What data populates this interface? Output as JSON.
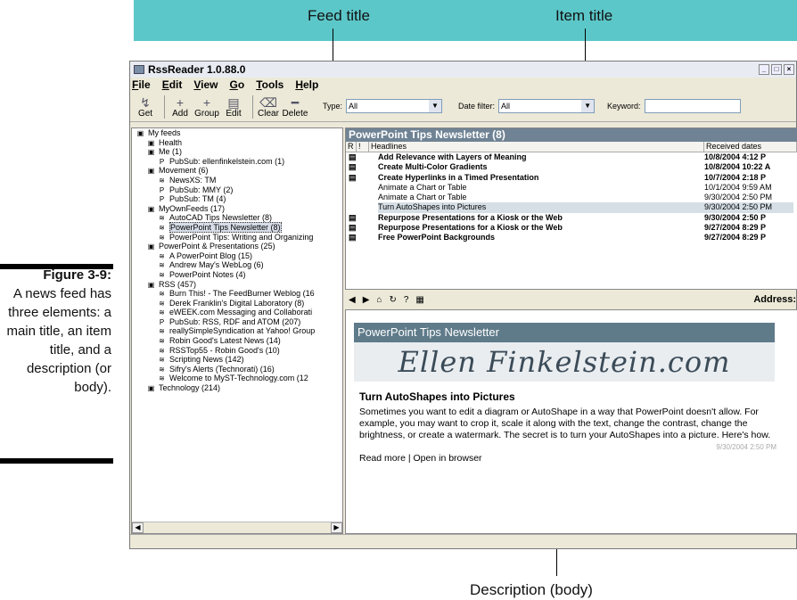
{
  "callouts": {
    "feed_title": "Feed title",
    "item_title": "Item title",
    "description": "Description (body)"
  },
  "caption": {
    "label": "Figure 3-9:",
    "text": "A news feed has three elements: a main title, an item title, and a description (or body)."
  },
  "window": {
    "title": "RssReader  1.0.88.0",
    "menu": [
      "File",
      "Edit",
      "View",
      "Go",
      "Tools",
      "Help"
    ],
    "toolbar": [
      "Get",
      "Add",
      "Group",
      "Edit",
      "Clear",
      "Delete"
    ],
    "filters": {
      "type_label": "Type:",
      "type_value": "All",
      "date_label": "Date filter:",
      "date_value": "All",
      "keyword_label": "Keyword:",
      "keyword_value": ""
    }
  },
  "tree": [
    {
      "level": 0,
      "icon": "folder",
      "label": "My feeds"
    },
    {
      "level": 1,
      "icon": "folder",
      "label": "Health"
    },
    {
      "level": 1,
      "icon": "folder",
      "label": "Me (1)"
    },
    {
      "level": 2,
      "icon": "pubsub",
      "label": "PubSub: ellenfinkelstein.com (1)"
    },
    {
      "level": 1,
      "icon": "folder",
      "label": "Movement (6)"
    },
    {
      "level": 2,
      "icon": "feed",
      "label": "NewsXS: TM"
    },
    {
      "level": 2,
      "icon": "pubsub",
      "label": "PubSub: MMY (2)"
    },
    {
      "level": 2,
      "icon": "pubsub",
      "label": "PubSub: TM (4)"
    },
    {
      "level": 1,
      "icon": "folder",
      "label": "MyOwnFeeds (17)"
    },
    {
      "level": 2,
      "icon": "feed",
      "label": "AutoCAD Tips Newsletter (8)"
    },
    {
      "level": 2,
      "icon": "feed",
      "label": "PowerPoint Tips Newsletter (8)",
      "selected": true
    },
    {
      "level": 2,
      "icon": "feed",
      "label": "PowerPoint Tips: Writing and Organizing"
    },
    {
      "level": 1,
      "icon": "folder",
      "label": "PowerPoint & Presentations (25)"
    },
    {
      "level": 2,
      "icon": "feed",
      "label": "A PowerPoint Blog (15)"
    },
    {
      "level": 2,
      "icon": "feed",
      "label": "Andrew May's WebLog (6)"
    },
    {
      "level": 2,
      "icon": "feed",
      "label": "PowerPoint Notes (4)"
    },
    {
      "level": 1,
      "icon": "folder",
      "label": "RSS (457)"
    },
    {
      "level": 2,
      "icon": "feed",
      "label": "Burn This! - The FeedBurner Weblog (16"
    },
    {
      "level": 2,
      "icon": "feed",
      "label": "Derek Franklin's Digital Laboratory (8)"
    },
    {
      "level": 2,
      "icon": "feed",
      "label": "eWEEK.com Messaging and Collaborati"
    },
    {
      "level": 2,
      "icon": "pubsub",
      "label": "PubSub: RSS, RDF and ATOM (207)"
    },
    {
      "level": 2,
      "icon": "feed",
      "label": "reallySimpleSyndication at Yahoo! Group"
    },
    {
      "level": 2,
      "icon": "feed",
      "label": "Robin Good's Latest News (14)"
    },
    {
      "level": 2,
      "icon": "feed",
      "label": "RSSTop55 - Robin Good's (10)"
    },
    {
      "level": 2,
      "icon": "feed",
      "label": "Scripting News (142)"
    },
    {
      "level": 2,
      "icon": "feed",
      "label": "Sifry's Alerts (Technorati) (16)"
    },
    {
      "level": 2,
      "icon": "feed",
      "label": "Welcome to MyST-Technology.com (12"
    },
    {
      "level": 1,
      "icon": "folder",
      "label": "Technology (214)"
    }
  ],
  "headlines": {
    "pane_title": "PowerPoint Tips Newsletter (8)",
    "columns": [
      "R",
      "!",
      "Headlines",
      "Received dates"
    ],
    "rows": [
      {
        "title": "Add Relevance with Layers of Meaning",
        "date": "10/8/2004 4:12 P",
        "bold": true
      },
      {
        "title": "Create Multi-Color Gradients",
        "date": "10/8/2004 10:22 A",
        "bold": true
      },
      {
        "title": "Create Hyperlinks in a Timed Presentation",
        "date": "10/7/2004 2:18 P",
        "bold": true
      },
      {
        "title": "Animate a Chart or Table",
        "date": "10/1/2004 9:59 AM",
        "bold": false
      },
      {
        "title": "Animate a Chart or Table",
        "date": "9/30/2004 2:50 PM",
        "bold": false
      },
      {
        "title": "Turn AutoShapes into Pictures",
        "date": "9/30/2004 2:50 PM",
        "bold": false,
        "selected": true
      },
      {
        "title": "Repurpose Presentations for a Kiosk or the Web",
        "date": "9/30/2004 2:50 P",
        "bold": true
      },
      {
        "title": "Repurpose Presentations for a Kiosk or the Web",
        "date": "9/27/2004 8:29 P",
        "bold": true
      },
      {
        "title": "Free PowerPoint Backgrounds",
        "date": "9/27/2004 8:29 P",
        "bold": true
      }
    ]
  },
  "browser": {
    "address_label": "Address:",
    "newsletter_header": "PowerPoint Tips Newsletter",
    "banner": "Ellen Finkelstein.com",
    "article_title": "Turn AutoShapes into Pictures",
    "article_body": "Sometimes you want to edit a diagram or AutoShape in a way that PowerPoint doesn't allow. For example, you may want to crop it, scale it along with the text, change the contrast, change the brightness, or create a watermark. The secret is to turn your AutoShapes into a picture. Here's how.",
    "article_date": "9/30/2004 2:50 PM",
    "links": "Read more | Open in browser"
  },
  "colors": {
    "band": "#5cc7c9",
    "pane_title_bg": "#6f8394",
    "newsletter_bg": "#5f7b8a"
  }
}
